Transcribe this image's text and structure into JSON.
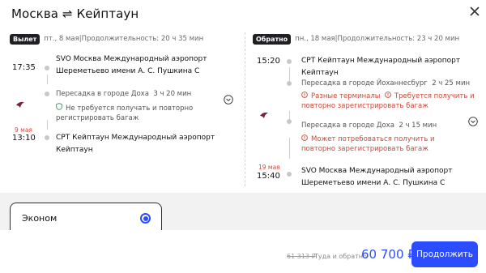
{
  "header": {
    "title": "Москва ⇌ Кейптаун",
    "close_icon": "close-icon"
  },
  "outbound": {
    "badge": "Вылет",
    "date": "пт., 8 мая",
    "duration": "Продолжительность: 20 ч 35 мин",
    "dep_time": "17:35",
    "dep_airport": "SVO Москва Международный аэропорт Шереметьево имени А. С. Пушкина С",
    "layover": "Пересадка в городе Доха",
    "layover_time": "3 ч 20 мин",
    "note_baggage": "Не требуется получать и повторно регистрировать багаж",
    "arr_date": "9 мая",
    "arr_time": "13:10",
    "arr_airport": "CPT Кейптаун Международный аэропорт Кейптаун"
  },
  "return": {
    "badge": "Обратно",
    "date": "пн., 18 мая",
    "duration": "Продолжительность: 23 ч 20 мин",
    "dep_time": "15:20",
    "dep_airport": "CPT Кейптаун Международный аэропорт Кейптаун",
    "layover1": "Пересадка в городе Йоханнесбург",
    "layover1_time": "2 ч 25 мин",
    "warn1a": "Разные терминалы",
    "warn1b": "Требуется получить и повторно зарегистрировать багаж",
    "layover2": "Пересадка в городе Доха",
    "layover2_time": "2 ч 15 мин",
    "warn2": "Может потребоваться получить и повторно зарегистрировать багаж",
    "arr_date": "19 мая",
    "arr_time": "15:40",
    "arr_airport": "SVO Москва Международный аэропорт Шереметьево имени А. С. Пушкина С"
  },
  "tariff": {
    "label": "Эконом",
    "selected": true
  },
  "footer": {
    "old_price": "61 313 ₽",
    "round_trip": "Туда и обратно",
    "price": "60 700 ₽",
    "cta": "Продолжить"
  },
  "colors": {
    "accent": "#2b4cff",
    "warning": "#c84a3b",
    "badge_bg": "#1f1f24"
  }
}
